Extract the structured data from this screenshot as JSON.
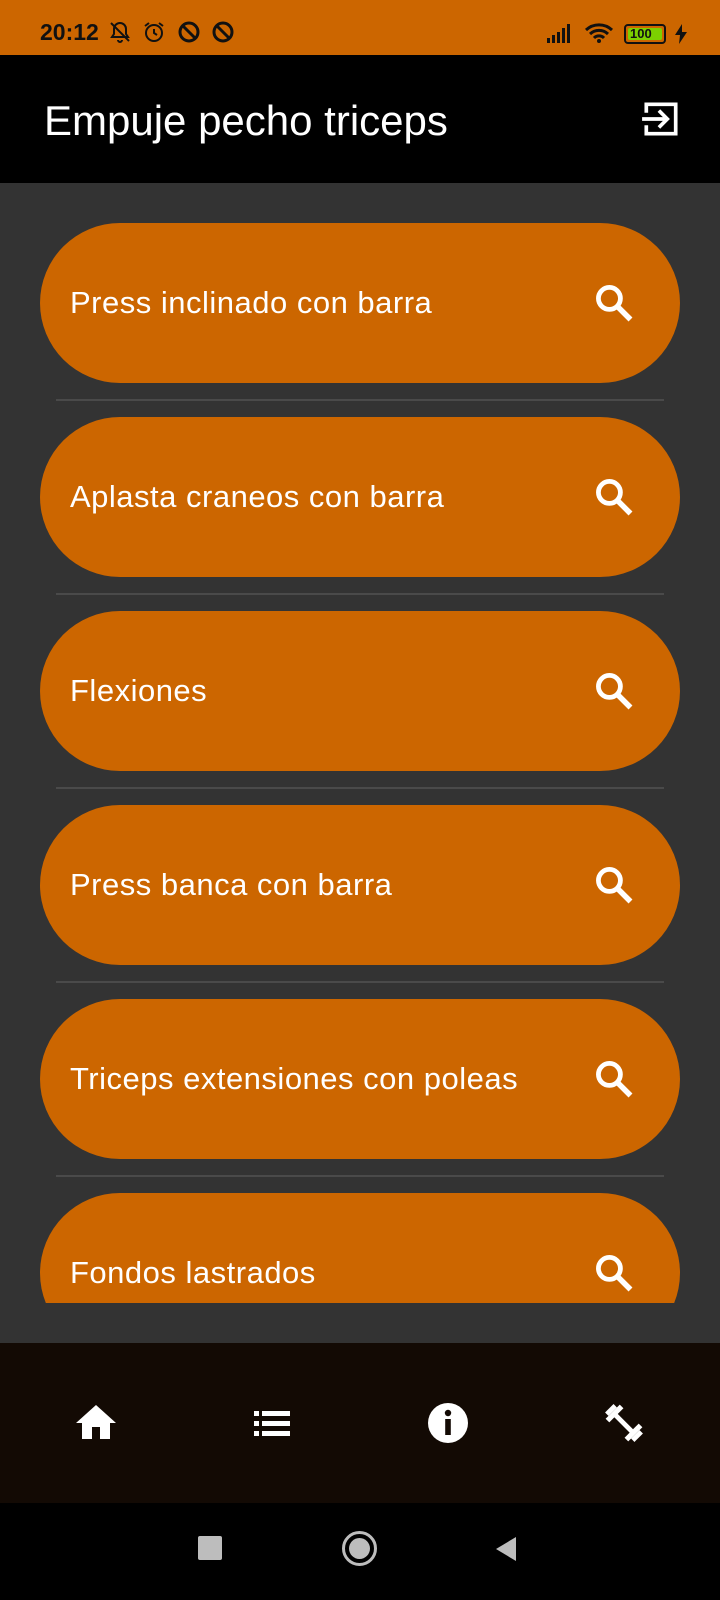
{
  "status_bar": {
    "time": "20:12",
    "battery": "100",
    "icons": [
      "bell-off-icon",
      "alarm-icon",
      "do-not-disturb-icon",
      "do-not-disturb-icon",
      "signal-icon",
      "wifi-icon",
      "battery-icon",
      "charging-icon"
    ],
    "background": "#cc6600"
  },
  "app_bar": {
    "title": "Empuje pecho triceps",
    "action_icon": "logout-icon"
  },
  "exercises": [
    {
      "label": "Press inclinado con barra",
      "icon": "search-icon"
    },
    {
      "label": "Aplasta craneos con barra",
      "icon": "search-icon"
    },
    {
      "label": "Flexiones",
      "icon": "search-icon"
    },
    {
      "label": "Press banca con barra",
      "icon": "search-icon"
    },
    {
      "label": "Triceps extensiones con poleas",
      "icon": "search-icon"
    },
    {
      "label": "Fondos lastrados",
      "icon": "search-icon"
    }
  ],
  "bottom_nav": {
    "items": [
      "home-icon",
      "list-icon",
      "info-icon",
      "dumbbell-icon"
    ]
  },
  "system_nav": {
    "items": [
      "recents-button",
      "home-button",
      "back-button"
    ]
  },
  "colors": {
    "accent": "#cc6600",
    "content_bg": "#333333",
    "app_bar_bg": "#000000",
    "bottom_nav_bg": "#130a04"
  }
}
